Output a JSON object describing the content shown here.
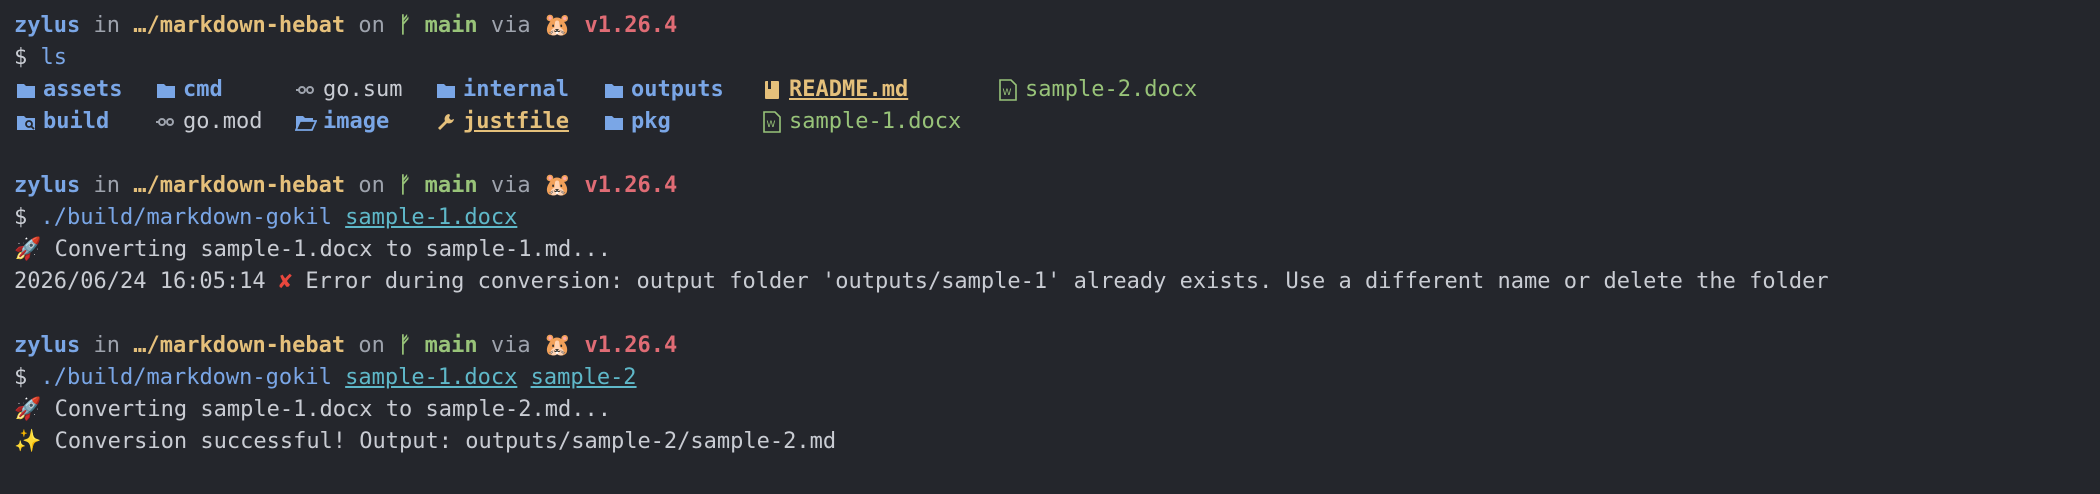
{
  "prompt": {
    "user": "zylus",
    "in": "in",
    "path": "…/markdown-hebat",
    "on": "on",
    "branch": "main",
    "via": "via",
    "version": "v1.26.4",
    "symbol": "$"
  },
  "block1": {
    "command": "ls",
    "listing": {
      "row1": [
        {
          "name": "assets",
          "kind": "dir",
          "icon": "folder-icon"
        },
        {
          "name": "cmd",
          "kind": "dir",
          "icon": "folder-icon"
        },
        {
          "name": "go.sum",
          "kind": "file",
          "icon": "link-icon"
        },
        {
          "name": "internal",
          "kind": "dir",
          "icon": "folder-icon"
        },
        {
          "name": "outputs",
          "kind": "dir",
          "icon": "folder-icon"
        },
        {
          "name": "README.md",
          "kind": "readme",
          "icon": "book-icon"
        },
        {
          "name": "sample-2.docx",
          "kind": "docx",
          "icon": "word-doc-icon"
        }
      ],
      "row2": [
        {
          "name": "build",
          "kind": "dir",
          "icon": "folder-search-icon"
        },
        {
          "name": "go.mod",
          "kind": "file",
          "icon": "link-icon"
        },
        {
          "name": "image",
          "kind": "dir",
          "icon": "folder-open-icon"
        },
        {
          "name": "justfile",
          "kind": "readme",
          "icon": "wrench-icon"
        },
        {
          "name": "pkg",
          "kind": "dir",
          "icon": "folder-icon"
        },
        {
          "name": "sample-1.docx",
          "kind": "docx",
          "icon": "word-doc-icon"
        }
      ]
    }
  },
  "block2": {
    "command": "./build/markdown-gokil",
    "arg1": "sample-1.docx",
    "out1": "Converting sample-1.docx to sample-1.md...",
    "out2_ts": "2026/06/24 16:05:14",
    "out2_msg": "Error during conversion: output folder 'outputs/sample-1' already exists. Use a different name or delete the folder"
  },
  "block3": {
    "command": "./build/markdown-gokil",
    "arg1": "sample-1.docx",
    "arg2": "sample-2",
    "out1": "Converting sample-1.docx to sample-2.md...",
    "out2": "Conversion successful! Output: outputs/sample-2/sample-2.md"
  },
  "colors": {
    "background": "#24262c",
    "user": "#7aa6e6",
    "path": "#e5c07b",
    "branch": "#98c379",
    "version": "#e06c75",
    "error": "#e8473d",
    "argument": "#5fb8c9"
  },
  "icons": [
    "git-branch-icon",
    "hamster-icon",
    "rocket-icon",
    "cross-mark-icon",
    "sparkles-icon"
  ]
}
